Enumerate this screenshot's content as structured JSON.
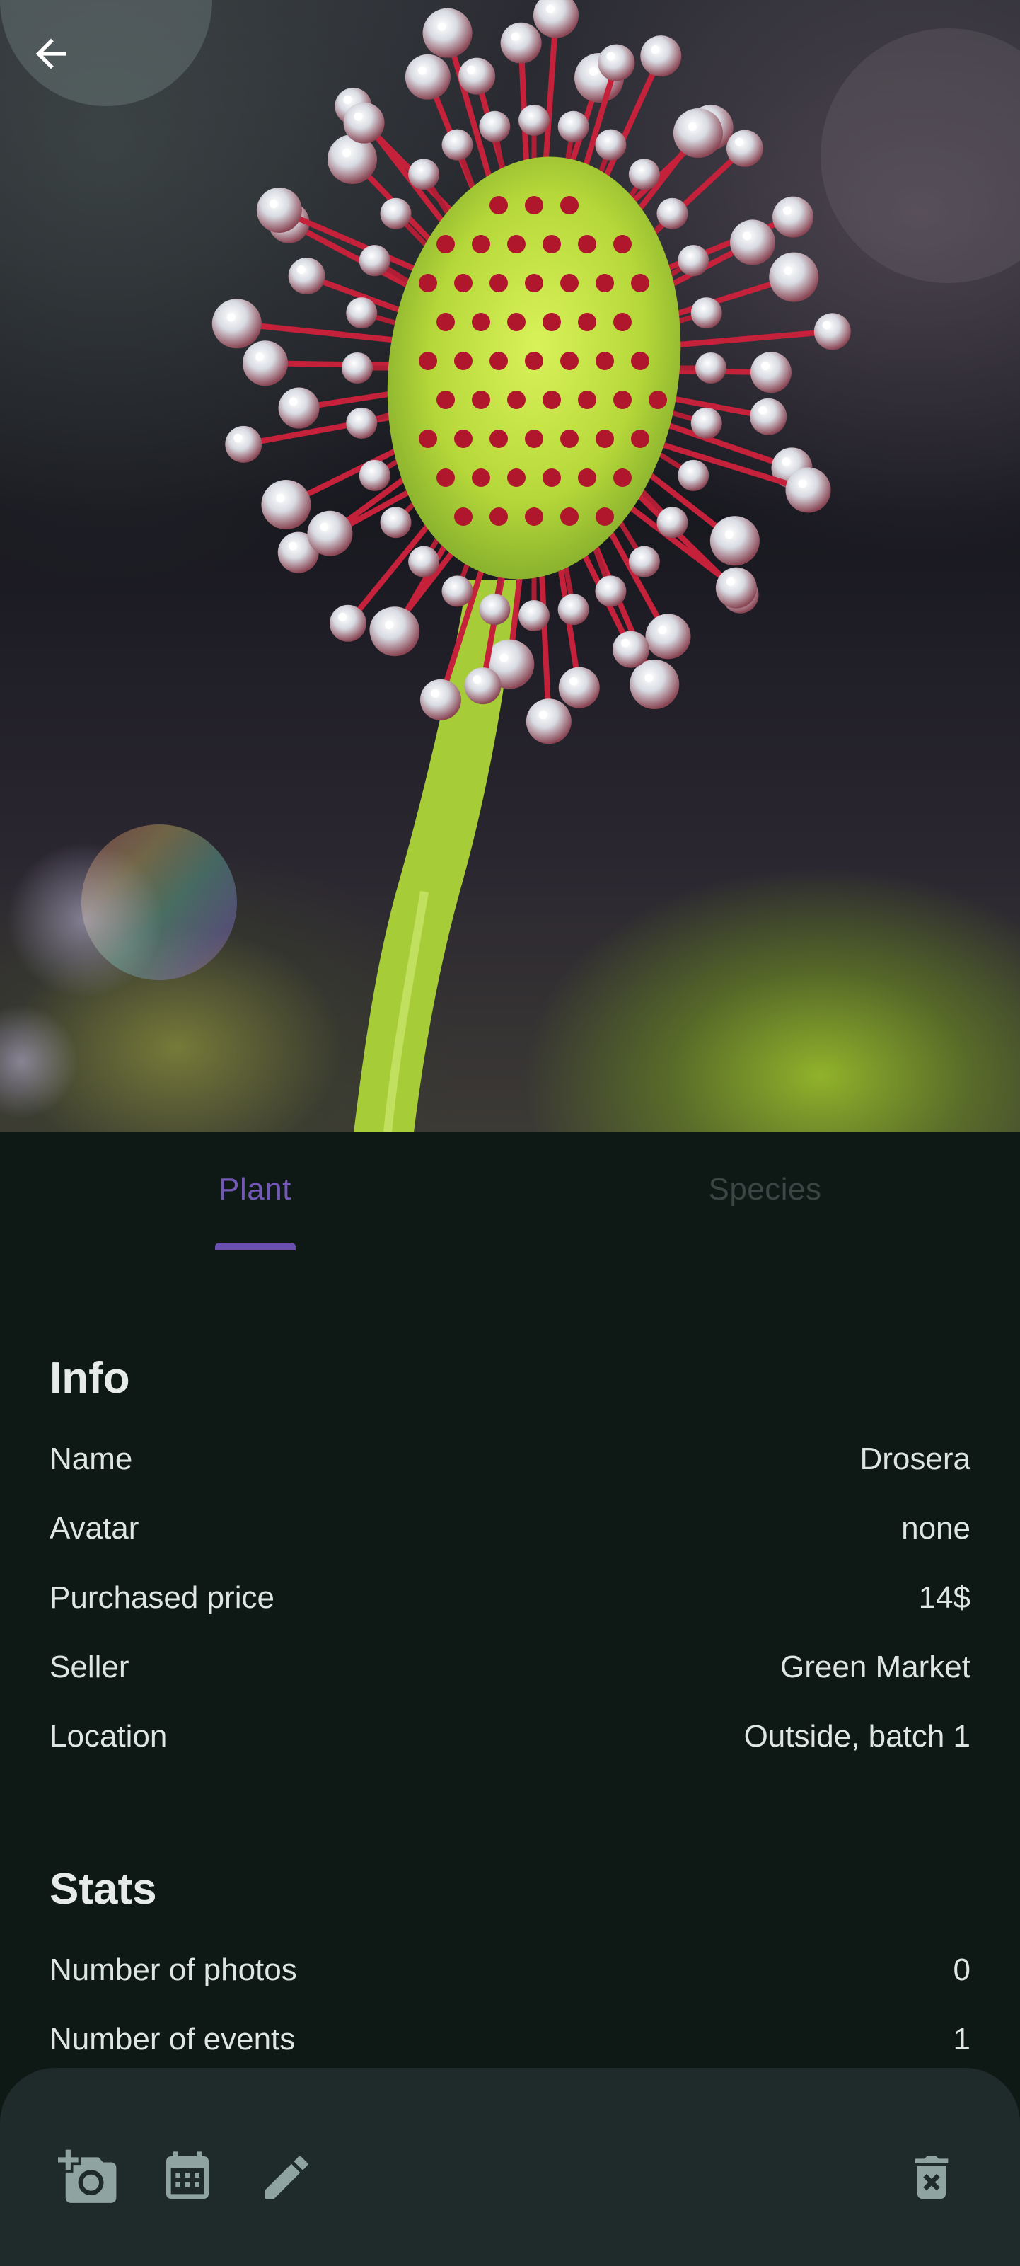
{
  "tabs": [
    {
      "label": "Plant",
      "active": true
    },
    {
      "label": "Species",
      "active": false
    }
  ],
  "info": {
    "title": "Info",
    "rows": [
      {
        "label": "Name",
        "value": "Drosera"
      },
      {
        "label": "Avatar",
        "value": "none"
      },
      {
        "label": "Purchased price",
        "value": "14$"
      },
      {
        "label": "Seller",
        "value": "Green Market"
      },
      {
        "label": "Location",
        "value": "Outside, batch 1"
      }
    ]
  },
  "stats": {
    "title": "Stats",
    "rows": [
      {
        "label": "Number of photos",
        "value": "0"
      },
      {
        "label": "Number of events",
        "value": "1"
      }
    ]
  },
  "toolbar": {
    "icons": [
      "add-photo-icon",
      "calendar-icon",
      "edit-icon",
      "delete-icon"
    ]
  },
  "colors": {
    "background": "#0e1916",
    "accent": "#6a4fb0",
    "bottom_bar": "#1f2b2b",
    "icon": "#8fa3a0"
  }
}
